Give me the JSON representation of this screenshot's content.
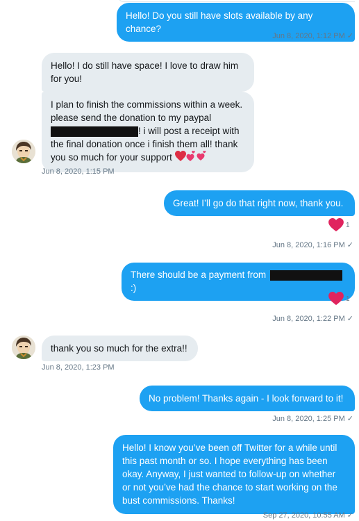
{
  "messages": [
    {
      "text": "Hello! Do you still have slots available by any chance?",
      "time": "Jun 8, 2020, 1:12 PM"
    },
    {
      "text": "Hello! I do still have space! I love to draw him for you!"
    },
    {
      "text_a": "I plan to finish the commissions within a week. please send the donation to my paypal",
      "text_b": "! i will post a receipt with the final donation once i finish them all! thank you so much for your support",
      "time": "Jun 8, 2020, 1:15 PM"
    },
    {
      "text": "Great! I’ll go do that right now, thank you.",
      "likes": "1",
      "time": "Jun 8, 2020, 1:16 PM"
    },
    {
      "text_a": "There should be a payment from",
      "text_b": ":)",
      "likes": "1",
      "time": "Jun 8, 2020, 1:22 PM"
    },
    {
      "text": "thank you so much for the extra!!",
      "time": "Jun 8, 2020, 1:23 PM"
    },
    {
      "text": "No problem! Thanks again - I look forward to it!",
      "time": "Jun 8, 2020, 1:25 PM"
    },
    {
      "text": "Hello! I know you’ve been off Twitter for a while until this past month or so. I hope everything has been okay. Anyway, I just wanted to follow-up on whether or not you’ve had the chance to start working on the bust commissions. Thanks!",
      "time": "Sep 27, 2020, 10:55 AM"
    }
  ],
  "icons": {
    "read_receipt": "check-icon",
    "like": "heart-icon",
    "avatar": "avatar"
  },
  "colors": {
    "outgoing_bubble": "#1da1f2",
    "incoming_bubble": "#e6ecf0",
    "meta_text": "#657786",
    "heart": "#e0245e"
  }
}
